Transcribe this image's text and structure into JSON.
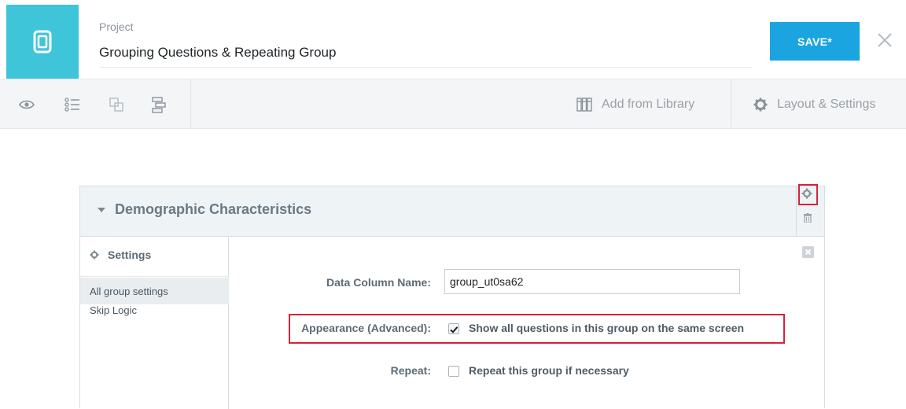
{
  "header": {
    "project_label": "Project",
    "project_title": "Grouping Questions & Repeating Group",
    "save_label": "SAVE*"
  },
  "toolbar": {
    "add_from_library": "Add from Library",
    "layout_settings": "Layout & Settings"
  },
  "group": {
    "title": "Demographic Characteristics",
    "sidebar": {
      "header": "Settings",
      "items": [
        {
          "label": "All group settings",
          "active": true
        },
        {
          "label": "Skip Logic",
          "active": false
        }
      ]
    },
    "fields": {
      "data_column_label": "Data Column Name:",
      "data_column_value": "group_ut0sa62",
      "appearance_label": "Appearance (Advanced):",
      "appearance_option": "Show all questions in this group on the same screen",
      "appearance_checked": true,
      "repeat_label": "Repeat:",
      "repeat_option": "Repeat this group if necessary",
      "repeat_checked": false
    }
  },
  "colors": {
    "brand": "#3fc5da",
    "save": "#1aa5e0",
    "highlight": "#d7223b"
  }
}
